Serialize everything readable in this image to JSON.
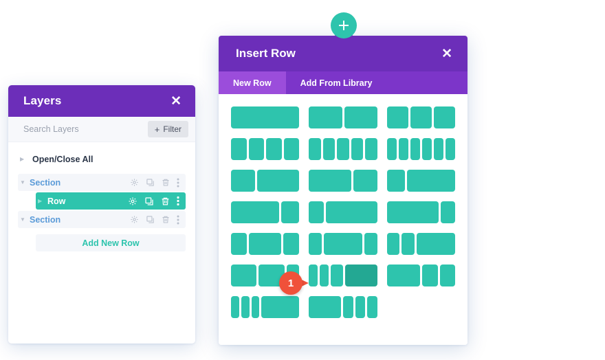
{
  "layers_panel": {
    "title": "Layers",
    "close_label": "✕",
    "search": {
      "placeholder": "Search Layers",
      "value": ""
    },
    "filter_button": {
      "plus": "+",
      "label": "Filter"
    },
    "tree": [
      {
        "label": "Open/Close All",
        "type": "root",
        "caret": "▶"
      },
      {
        "label": "Section",
        "type": "section",
        "caret": "▼"
      },
      {
        "label": "Row",
        "type": "row",
        "caret": "▶",
        "selected": true
      },
      {
        "label": "Section",
        "type": "section",
        "caret": "▼"
      }
    ],
    "add_new_row_label": "Add New Row",
    "row_action_icons": [
      "gear-icon",
      "duplicate-icon",
      "trash-icon",
      "more-options-icon"
    ]
  },
  "insert_row_modal": {
    "title": "Insert Row",
    "close_label": "✕",
    "tabs": [
      {
        "label": "New Row",
        "active": true
      },
      {
        "label": "Add From Library",
        "active": false
      }
    ],
    "add_section_button_icon": "plus-icon"
  },
  "chart_data": {
    "type": "table",
    "title": "Row Column Layout Options",
    "columns": 3,
    "rows": 7,
    "layouts": [
      {
        "index": 1,
        "name": "1 column",
        "widths": [
          100
        ]
      },
      {
        "index": 2,
        "name": "2 columns 1/2 1/2",
        "widths": [
          50,
          50
        ]
      },
      {
        "index": 3,
        "name": "3 columns 1/3 1/3 1/3",
        "widths": [
          33.3,
          33.3,
          33.3
        ]
      },
      {
        "index": 4,
        "name": "4 columns 1/4 each",
        "widths": [
          25,
          25,
          25,
          25
        ]
      },
      {
        "index": 5,
        "name": "5 columns 1/5 each",
        "widths": [
          20,
          20,
          20,
          20,
          20
        ]
      },
      {
        "index": 6,
        "name": "6 columns 1/6 each",
        "widths": [
          16.6,
          16.6,
          16.6,
          16.6,
          16.6,
          16.6
        ]
      },
      {
        "index": 7,
        "name": "2 columns 1/3 2/3",
        "widths": [
          36,
          64
        ]
      },
      {
        "index": 8,
        "name": "2 columns 2/3 1/3",
        "widths": [
          64,
          36
        ]
      },
      {
        "index": 9,
        "name": "2 columns 1/4 3/4",
        "widths": [
          27,
          73
        ]
      },
      {
        "index": 10,
        "name": "2 columns 3/4 1/4",
        "widths": [
          73,
          27
        ]
      },
      {
        "index": 11,
        "name": "2 columns 1/5 4/5",
        "widths": [
          22,
          78
        ]
      },
      {
        "index": 12,
        "name": "2 columns 4/5 1/5",
        "widths": [
          78,
          22
        ]
      },
      {
        "index": 13,
        "name": "3 columns 1/4 1/2 1/4",
        "widths": [
          25,
          50,
          25
        ]
      },
      {
        "index": 14,
        "name": "3 columns 1/5 3/5 1/5",
        "widths": [
          20,
          60,
          20
        ]
      },
      {
        "index": 15,
        "name": "3 columns 1/5 1/5 3/5",
        "widths": [
          20,
          20,
          60
        ]
      },
      {
        "index": 16,
        "name": "3 columns 2/5 2/5 1/5",
        "widths": [
          40,
          40,
          20
        ]
      },
      {
        "index": 17,
        "name": "4 columns 1/5 1/5 1/5 2/5",
        "widths": [
          14,
          14,
          20,
          52
        ],
        "hovered": true,
        "hot_cell": 3
      },
      {
        "index": 18,
        "name": "3 columns 2/4 1/4 1/4",
        "widths": [
          52,
          24,
          24
        ]
      },
      {
        "index": 19,
        "name": "4 columns 1/6 1/6 1/6 1/2",
        "widths": [
          13,
          13,
          13,
          61
        ]
      },
      {
        "index": 20,
        "name": "4 columns 1/2 1/6 1/6 1/6",
        "widths": [
          52,
          16,
          16,
          16
        ]
      },
      {
        "index": 21,
        "name": "empty",
        "widths": []
      }
    ],
    "colors": {
      "cell": "#2ec4ad",
      "cell_hover": "#23a893",
      "modal_header": "#6c2eb9",
      "tab_active": "#9b4ddb",
      "tab_inactive": "#7c35c9"
    }
  },
  "cursor_marker": {
    "number": "1",
    "color": "#f0513a"
  }
}
